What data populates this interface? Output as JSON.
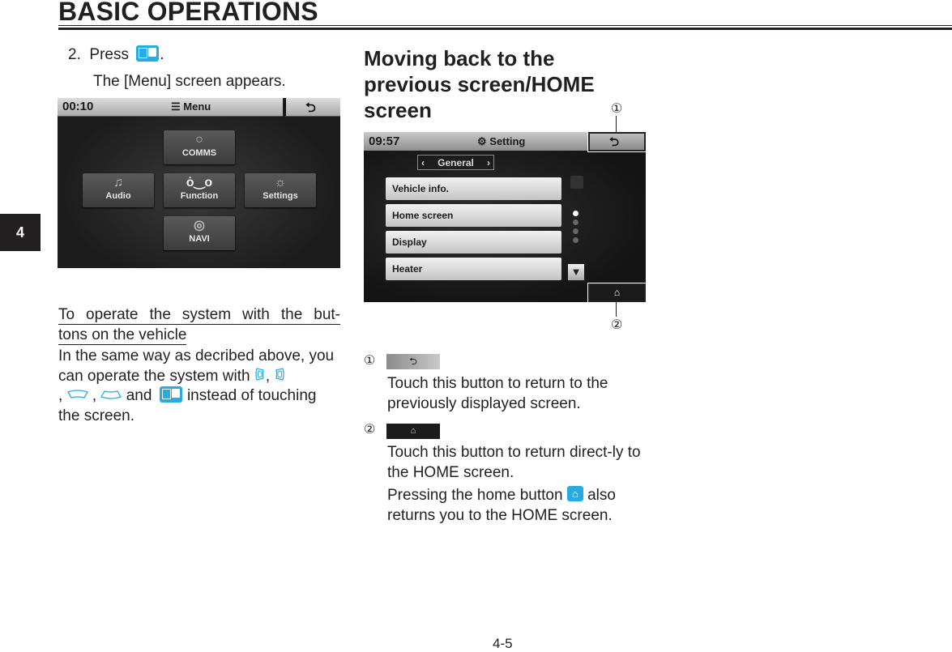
{
  "header": {
    "title": "BASIC OPERATIONS",
    "chapter_tab": "4"
  },
  "left": {
    "step_number": "2.",
    "step_text_before": "Press",
    "step_text_after": ".",
    "step_button_icon": "menu-button-icon",
    "step_result": "The [Menu] screen appears.",
    "menu_screen": {
      "clock": "00:10",
      "title": "Menu",
      "title_icon": "hamburger-icon",
      "back_icon": "return-arrow-icon",
      "tiles": [
        {
          "label": "COMMS",
          "icon": "speech-bubble-icon",
          "glyph": "💬"
        },
        {
          "label": "Audio",
          "icon": "music-note-icon",
          "glyph": "♫"
        },
        {
          "label": "Function",
          "icon": "motorcycle-icon",
          "glyph": "🏍"
        },
        {
          "label": "Settings",
          "icon": "gear-icon",
          "glyph": "☼"
        },
        {
          "label": "NAVI",
          "icon": "compass-icon",
          "glyph": "◎"
        }
      ]
    },
    "subheading_line1": "To operate the system with the but-",
    "subheading_line2": "tons on the vehicle",
    "paragraph": {
      "part1": "In the same way as decribed above, you can operate the system with",
      "sep1": ",",
      "sep2": ",",
      "sep3": ",",
      "and": "and",
      "part2": "instead of touching the screen.",
      "icons": [
        "left-key-icon",
        "right-key-icon",
        "up-key-icon",
        "down-key-icon",
        "menu-button-icon"
      ]
    }
  },
  "right": {
    "section_title": "Moving back to the previous screen/HOME screen",
    "callouts": [
      "①",
      "②"
    ],
    "setting_screen": {
      "clock": "09:57",
      "title": "Setting",
      "title_icon": "gear-icon",
      "category": "General",
      "items": [
        "Vehicle info.",
        "Home screen",
        "Display",
        "Heater"
      ],
      "page_indicator": {
        "total": 4,
        "active": 1
      },
      "back_glyph": "⮌",
      "home_glyph": "⌂",
      "down_glyph": "▼",
      "prev_glyph": "‹",
      "next_glyph": "›"
    },
    "desc1": {
      "num": "①",
      "text": "Touch this button to return to the previously displayed screen."
    },
    "desc2": {
      "num": "②",
      "text": "Touch this button to return direct-ly to the HOME screen.",
      "text2_before": "Pressing the home button",
      "text2_after": "also returns you to the HOME screen."
    }
  },
  "footer": {
    "page_number": "4-5"
  },
  "colors": {
    "accent": "#29abe2",
    "text": "#231f20"
  }
}
